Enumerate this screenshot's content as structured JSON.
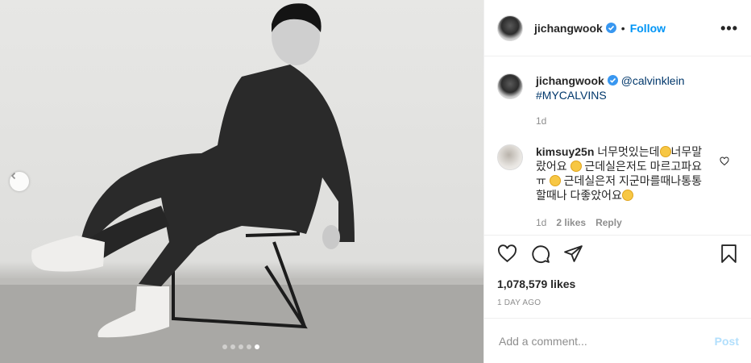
{
  "header": {
    "username": "jichangwook",
    "bullet": "•",
    "follow_label": "Follow",
    "more_label": "•••"
  },
  "caption": {
    "username": "jichangwook",
    "mention": "@calvinklein",
    "hashtag": "#MYCALVINS",
    "time": "1d"
  },
  "comment": {
    "username": "kimsuy25n",
    "part1": "너무멋있는데",
    "part2": "너무말랐어요",
    "part3": "근데실은저도 마르고파요ㅠ",
    "part4": "근데실은저 지군마를때나통통할때나 다좋았어요",
    "time": "1d",
    "likes": "2 likes",
    "reply": "Reply"
  },
  "post_stats": {
    "likes": "1,078,579 likes",
    "ago": "1 DAY AGO"
  },
  "add_comment": {
    "placeholder": "Add a comment...",
    "post_label": "Post"
  },
  "carousel": {
    "total": 5,
    "active_index": 4
  },
  "colors": {
    "accent": "#0095f6",
    "link": "#00376b",
    "muted": "#8e8e8e",
    "post_disabled": "#b2dffc"
  }
}
